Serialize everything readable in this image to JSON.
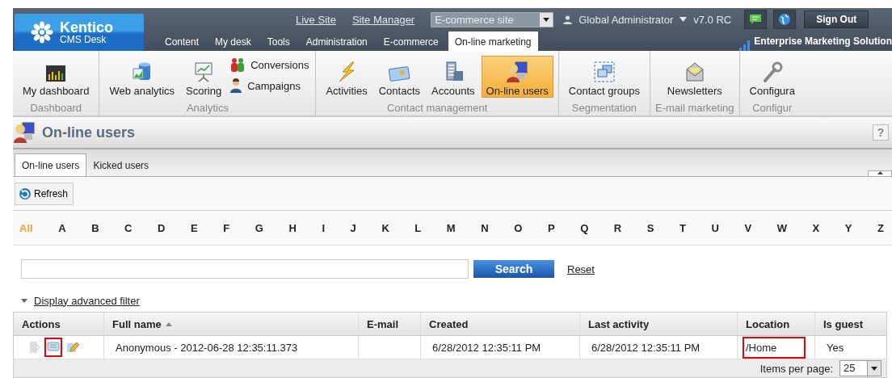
{
  "header": {
    "logo": {
      "name": "Kentico",
      "subtitle": "CMS Desk"
    },
    "links": [
      "Live Site",
      "Site Manager"
    ],
    "site_select": {
      "value": "E-commerce site"
    },
    "user": "Global Administrator",
    "version": "v7.0 RC",
    "sign_out": "Sign Out",
    "edition": "Enterprise Marketing Solution",
    "tabs": [
      {
        "label": "Content",
        "selected": false
      },
      {
        "label": "My desk",
        "selected": false
      },
      {
        "label": "Tools",
        "selected": false
      },
      {
        "label": "Administration",
        "selected": false
      },
      {
        "label": "E-commerce",
        "selected": false
      },
      {
        "label": "On-line marketing",
        "selected": true
      }
    ]
  },
  "ribbon": [
    {
      "label": "Dashboard",
      "items": [
        {
          "label": "My dashboard",
          "kind": "dashboard",
          "selected": false
        }
      ]
    },
    {
      "label": "Analytics",
      "items": [
        {
          "label": "Web analytics",
          "kind": "database",
          "selected": false
        },
        {
          "label": "Scoring",
          "kind": "easel",
          "selected": false
        },
        {
          "label": "Conversions",
          "kind": "people",
          "selected": false
        },
        {
          "label": "Campaigns",
          "kind": "person",
          "selected": false
        }
      ]
    },
    {
      "label": "Contact management",
      "items": [
        {
          "label": "Activities",
          "kind": "lightning",
          "selected": false
        },
        {
          "label": "Contacts",
          "kind": "card",
          "selected": false
        },
        {
          "label": "Accounts",
          "kind": "building",
          "selected": false
        },
        {
          "label": "On-line users",
          "kind": "usercomputer",
          "selected": true
        }
      ]
    },
    {
      "label": "Segmentation",
      "items": [
        {
          "label": "Contact groups",
          "kind": "windows",
          "selected": false
        }
      ]
    },
    {
      "label": "E-mail marketing",
      "items": [
        {
          "label": "Newsletters",
          "kind": "envelope",
          "selected": false
        }
      ]
    },
    {
      "label": "Configur",
      "items": [
        {
          "label": "Configura",
          "kind": "wrench",
          "selected": false
        }
      ]
    }
  ],
  "page": {
    "title": "On-line users",
    "help": "?",
    "tabs": [
      {
        "label": "On-line users",
        "selected": true
      },
      {
        "label": "Kicked users",
        "selected": false
      }
    ],
    "toolbar": [
      "Refresh"
    ],
    "letters": [
      {
        "label": "All",
        "selected": true
      },
      {
        "label": "A",
        "selected": false
      },
      {
        "label": "B",
        "selected": false
      },
      {
        "label": "C",
        "selected": false
      },
      {
        "label": "D",
        "selected": false
      },
      {
        "label": "E",
        "selected": false
      },
      {
        "label": "F",
        "selected": false
      },
      {
        "label": "G",
        "selected": false
      },
      {
        "label": "H",
        "selected": false
      },
      {
        "label": "I",
        "selected": false
      },
      {
        "label": "J",
        "selected": false
      },
      {
        "label": "K",
        "selected": false
      },
      {
        "label": "L",
        "selected": false
      },
      {
        "label": "M",
        "selected": false
      },
      {
        "label": "N",
        "selected": false
      },
      {
        "label": "O",
        "selected": false
      },
      {
        "label": "P",
        "selected": false
      },
      {
        "label": "Q",
        "selected": false
      },
      {
        "label": "R",
        "selected": false
      },
      {
        "label": "S",
        "selected": false
      },
      {
        "label": "T",
        "selected": false
      },
      {
        "label": "U",
        "selected": false
      },
      {
        "label": "V",
        "selected": false
      },
      {
        "label": "W",
        "selected": false
      },
      {
        "label": "X",
        "selected": false
      },
      {
        "label": "Y",
        "selected": false
      },
      {
        "label": "Z",
        "selected": false
      }
    ],
    "search": {
      "button": "Search",
      "reset": "Reset"
    },
    "filter_link": "Display advanced filter",
    "table": {
      "columns": [
        {
          "label": "Actions",
          "sorted": false
        },
        {
          "label": "Full name",
          "sorted": true
        },
        {
          "label": "E-mail",
          "sorted": false
        },
        {
          "label": "Created",
          "sorted": false
        },
        {
          "label": "Last activity",
          "sorted": false
        },
        {
          "label": "Location",
          "sorted": false
        },
        {
          "label": "Is guest",
          "sorted": false
        }
      ],
      "rows": [
        {
          "cells": [
            {
              "actions": [
                {
                  "kind": "kick",
                  "disabled": true,
                  "highlighted": false
                },
                {
                  "kind": "message",
                  "disabled": false,
                  "highlighted": true
                },
                {
                  "kind": "edit",
                  "disabled": false,
                  "highlighted": false
                }
              ]
            },
            {
              "text": "Anonymous - 2012-06-28 12:35:11.373",
              "highlighted": false
            },
            {
              "text": "",
              "highlighted": false
            },
            {
              "text": "6/28/2012 12:35:11 PM",
              "highlighted": false
            },
            {
              "text": "6/28/2012 12:35:11 PM",
              "highlighted": false
            },
            {
              "text": "/Home",
              "highlighted": true
            },
            {
              "text": "Yes",
              "highlighted": false
            }
          ]
        }
      ]
    },
    "pager": {
      "label": "Items per page:",
      "value": "25"
    }
  }
}
